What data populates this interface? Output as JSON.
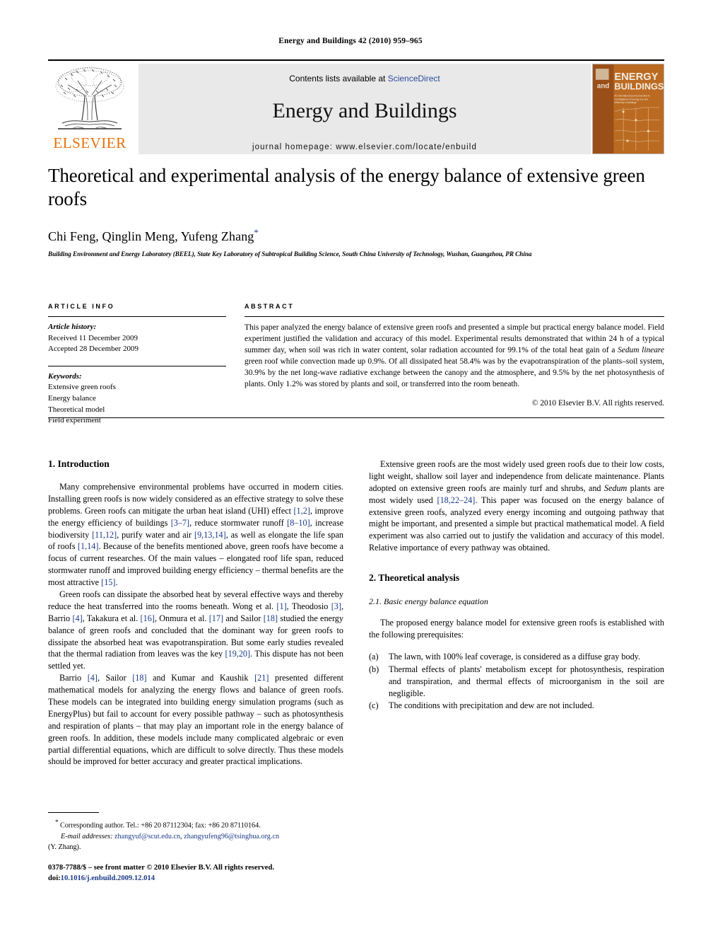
{
  "running_head": "Energy and Buildings 42 (2010) 959–965",
  "masthead": {
    "contents_prefix": "Contents lists available at",
    "contents_link": "ScienceDirect",
    "journal_title": "Energy and Buildings",
    "homepage_label": "journal homepage: www.elsevier.com/locate/enbuild",
    "publisher_name": "ELSEVIER",
    "cover": {
      "line1": "and",
      "line2": "ENERGY",
      "line3": "BUILDINGS",
      "subtitle": "An international journal devoted to investigations of energy use and efficiency in buildings"
    }
  },
  "article": {
    "title": "Theoretical and experimental analysis of the energy balance of extensive green roofs",
    "authors": "Chi Feng, Qinglin Meng, Yufeng Zhang",
    "corresponding_marker": "*",
    "affiliation": "Building Environment and Energy Laboratory (BEEL), State Key Laboratory of Subtropical Building Science, South China University of Technology, Wushan, Guangzhou, PR China"
  },
  "article_info": {
    "heading": "ARTICLE INFO",
    "history_label": "Article history:",
    "history": [
      "Received 11 December 2009",
      "Accepted 28 December 2009"
    ],
    "keywords_label": "Keywords:",
    "keywords": [
      "Extensive green roofs",
      "Energy balance",
      "Theoretical model",
      "Field experiment"
    ]
  },
  "abstract": {
    "heading": "ABSTRACT",
    "part1": "This paper analyzed the energy balance of extensive green roofs and presented a simple but practical energy balance model. Field experiment justified the validation and accuracy of this model. Experimental results demonstrated that within 24 h of a typical summer day, when soil was rich in water content, solar radiation accounted for 99.1% of the total heat gain of a ",
    "species": "Sedum lineare",
    "part2": " green roof while convection made up 0.9%. Of all dissipated heat 58.4% was by the evapotranspiration of the plants–soil system, 30.9% by the net long-wave radiative exchange between the canopy and the atmosphere, and 9.5% by the net photosynthesis of plants. Only 1.2% was stored by plants and soil, or transferred into the room beneath.",
    "copyright": "© 2010 Elsevier B.V. All rights reserved."
  },
  "sections": {
    "introduction_heading": "1. Introduction",
    "theoretical_heading": "2. Theoretical analysis",
    "basic_eq_heading": "2.1. Basic energy balance equation"
  },
  "intro": {
    "p1_a": "Many comprehensive environmental problems have occurred in modern cities. Installing green roofs is now widely considered as an effective strategy to solve these problems. Green roofs can mitigate the urban heat island (UHI) effect ",
    "p1_r1": "[1,2]",
    "p1_b": ", improve the energy efficiency of buildings ",
    "p1_r2": "[3–7]",
    "p1_c": ", reduce stormwater runoff ",
    "p1_r3": "[8–10]",
    "p1_d": ", increase biodiversity ",
    "p1_r4": "[11,12]",
    "p1_e": ", purify water and air ",
    "p1_r5": "[9,13,14]",
    "p1_f": ", as well as elongate the life span of roofs ",
    "p1_r6": "[1,14]",
    "p1_g": ". Because of the benefits mentioned above, green roofs have become a focus of current researches. Of the main values – elongated roof life span, reduced stormwater runoff and improved building energy efficiency – thermal benefits are the most attractive ",
    "p1_r7": "[15]",
    "p1_h": ".",
    "p2_a": "Green roofs can dissipate the absorbed heat by several effective ways and thereby reduce the heat transferred into the rooms beneath. Wong et al. ",
    "p2_r1": "[1]",
    "p2_b": ", Theodosio ",
    "p2_r2": "[3]",
    "p2_c": ", Barrio ",
    "p2_r3": "[4]",
    "p2_d": ", Takakura et al. ",
    "p2_r4": "[16]",
    "p2_e": ", Onmura et al. ",
    "p2_r5": "[17]",
    "p2_f": " and Sailor ",
    "p2_r6": "[18]",
    "p2_g": " studied the energy balance of green roofs and concluded that the dominant way for green roofs to dissipate the absorbed heat was evapotranspiration. But some early studies revealed that the thermal radiation from leaves was the key ",
    "p2_r7": "[19,20]",
    "p2_h": ". This dispute has not been settled yet.",
    "p3_a": "Barrio ",
    "p3_r1": "[4]",
    "p3_b": ", Sailor ",
    "p3_r2": "[18]",
    "p3_c": " and Kumar and Kaushik ",
    "p3_r3": "[21]",
    "p3_d": " presented different mathematical models for analyzing the energy flows and balance of green roofs. These models can be integrated into building energy simulation programs (such as EnergyPlus) but fail to account for every possible pathway – such as photosynthesis and respiration of plants – that may play an important role in the energy balance of green roofs. In addition, these models include many complicated algebraic or even partial differential equations, which are difficult to solve directly. Thus these models should be improved for better accuracy and greater practical implications.",
    "p4_a": "Extensive green roofs are the most widely used green roofs due to their low costs, light weight, shallow soil layer and independence from delicate maintenance. Plants adopted on extensive green roofs are mainly turf and shrubs, and ",
    "p4_sp": "Sedum",
    "p4_b": " plants are most widely used ",
    "p4_r1": "[18,22–24]",
    "p4_c": ". This paper was focused on the energy balance of extensive green roofs, analyzed every energy incoming and outgoing pathway that might be important, and presented a simple but practical mathematical model. A field experiment was also carried out to justify the validation and accuracy of this model. Relative importance of every pathway was obtained."
  },
  "theoretical": {
    "intro_para": "The proposed energy balance model for extensive green roofs is established with the following prerequisites:",
    "items": [
      {
        "marker": "(a)",
        "text": "The lawn, with 100% leaf coverage, is considered as a diffuse gray body."
      },
      {
        "marker": "(b)",
        "text": "Thermal effects of plants' metabolism except for photosynthesis, respiration and transpiration, and thermal effects of microorganism in the soil are negligible."
      },
      {
        "marker": "(c)",
        "text": "The conditions with precipitation and dew are not included."
      }
    ]
  },
  "footnotes": {
    "corresponding_marker": "*",
    "corresponding": " Corresponding author. Tel.: +86 20 87112304; fax: +86 20 87110164.",
    "email_label": "E-mail addresses:",
    "email1": "zhangyuf@scut.edu.cn",
    "email_sep": ", ",
    "email2": "zhangyufeng96@tsinghua.org.cn",
    "email_author": "(Y. Zhang)."
  },
  "imprint": {
    "issn_line": "0378-7788/$ – see front matter © 2010 Elsevier B.V. All rights reserved.",
    "doi_label": "doi:",
    "doi": "10.1016/j.enbuild.2009.12.014"
  },
  "colors": {
    "link": "#1b3a87",
    "sciencedirect": "#2a4b9b",
    "elsevier_orange": "#e8700a",
    "masthead_bg": "#e9e9e9",
    "cover_bg": "#b9651f"
  }
}
